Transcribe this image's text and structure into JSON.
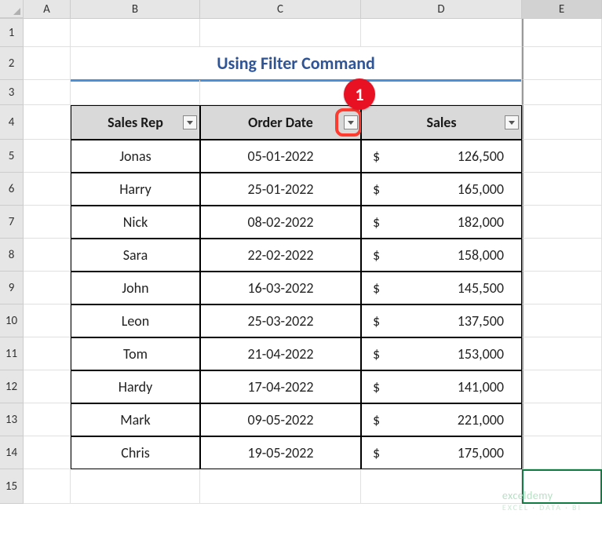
{
  "columns": {
    "A": "A",
    "B": "B",
    "C": "C",
    "D": "D",
    "E": "E"
  },
  "rowNums": [
    "1",
    "2",
    "3",
    "4",
    "5",
    "6",
    "7",
    "8",
    "9",
    "10",
    "11",
    "12",
    "13",
    "14",
    "15"
  ],
  "title": "Using Filter Command",
  "annotation": {
    "badge": "1"
  },
  "headers": {
    "sales_rep": "Sales Rep",
    "order_date": "Order Date",
    "sales": "Sales"
  },
  "rows": [
    {
      "rep": "Jonas",
      "date": "05-01-2022",
      "cur": "$",
      "sales": "126,500"
    },
    {
      "rep": "Harry",
      "date": "25-01-2022",
      "cur": "$",
      "sales": "165,000"
    },
    {
      "rep": "Nick",
      "date": "08-02-2022",
      "cur": "$",
      "sales": "182,000"
    },
    {
      "rep": "Sara",
      "date": "22-02-2022",
      "cur": "$",
      "sales": "158,000"
    },
    {
      "rep": "John",
      "date": "16-03-2022",
      "cur": "$",
      "sales": "145,500"
    },
    {
      "rep": "Leon",
      "date": "25-03-2022",
      "cur": "$",
      "sales": "137,500"
    },
    {
      "rep": "Tom",
      "date": "21-04-2022",
      "cur": "$",
      "sales": "153,000"
    },
    {
      "rep": "Hardy",
      "date": "17-04-2022",
      "cur": "$",
      "sales": "141,000"
    },
    {
      "rep": "Mark",
      "date": "09-05-2022",
      "cur": "$",
      "sales": "221,000"
    },
    {
      "rep": "Chris",
      "date": "19-05-2022",
      "cur": "$",
      "sales": "175,000"
    }
  ],
  "watermark": {
    "main": "exceldemy",
    "sub": "EXCEL · DATA · BI"
  }
}
